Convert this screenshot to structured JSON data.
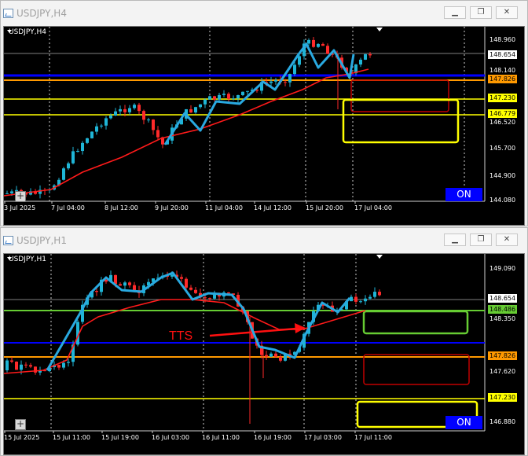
{
  "windows": [
    {
      "title": "USDJPY,H4",
      "symbol_label": "USDJPY,H4",
      "buttons": {
        "minimize": "▁",
        "restore": "❐",
        "close": "✕"
      },
      "price_labels": [
        {
          "text": "148.960",
          "bg": "transparent",
          "fg": "#ffffff"
        },
        {
          "text": "148.654",
          "bg": "#ffffff",
          "fg": "#000000"
        },
        {
          "text": "148.140",
          "bg": "transparent",
          "fg": "#ffffff"
        },
        {
          "text": "147.826",
          "bg": "#ff9900",
          "fg": "#000000"
        },
        {
          "text": "147.230",
          "bg": "#ffff00",
          "fg": "#000000"
        },
        {
          "text": "146.779",
          "bg": "#ffff00",
          "fg": "#000000"
        },
        {
          "text": "146.520",
          "bg": "transparent",
          "fg": "#ffffff"
        },
        {
          "text": "145.700",
          "bg": "transparent",
          "fg": "#ffffff"
        },
        {
          "text": "144.900",
          "bg": "transparent",
          "fg": "#ffffff"
        },
        {
          "text": "144.080",
          "bg": "transparent",
          "fg": "#ffffff"
        }
      ],
      "time_labels": [
        "3 Jul 2025",
        "7 Jul 04:00",
        "8 Jul 12:00",
        "9 Jul 20:00",
        "11 Jul 04:00",
        "14 Jul 12:00",
        "15 Jul 20:00",
        "17 Jul 04:00"
      ],
      "on_button": "ON",
      "plus_button": "+"
    },
    {
      "title": "USDJPY,H1",
      "symbol_label": "USDJPY,H1",
      "buttons": {
        "minimize": "▁",
        "restore": "❐",
        "close": "✕"
      },
      "price_labels": [
        {
          "text": "149.090",
          "bg": "transparent",
          "fg": "#ffffff"
        },
        {
          "text": "148.654",
          "bg": "#ffffff",
          "fg": "#000000"
        },
        {
          "text": "148.486",
          "bg": "#66cc33",
          "fg": "#000000"
        },
        {
          "text": "148.350",
          "bg": "transparent",
          "fg": "#ffffff"
        },
        {
          "text": "147.826",
          "bg": "#ff9900",
          "fg": "#000000"
        },
        {
          "text": "147.620",
          "bg": "transparent",
          "fg": "#ffffff"
        },
        {
          "text": "147.230",
          "bg": "#ffff00",
          "fg": "#000000"
        },
        {
          "text": "146.880",
          "bg": "transparent",
          "fg": "#ffffff"
        }
      ],
      "time_labels": [
        "15 Jul 2025",
        "15 Jul 11:00",
        "15 Jul 19:00",
        "16 Jul 03:00",
        "16 Jul 11:00",
        "16 Jul 19:00",
        "17 Jul 03:00",
        "17 Jul 11:00"
      ],
      "annotation": "TTS",
      "on_button": "ON",
      "plus_button": "+"
    }
  ],
  "colors": {
    "bull": "#1fb5d6",
    "bear": "#ff2a2a",
    "ma_red": "#ff1a1a",
    "zigzag": "#29a9e0",
    "blue_line": "#0000ff",
    "orange_line": "#ff9900",
    "yellow_line": "#ffff00",
    "green_line": "#66cc33"
  }
}
